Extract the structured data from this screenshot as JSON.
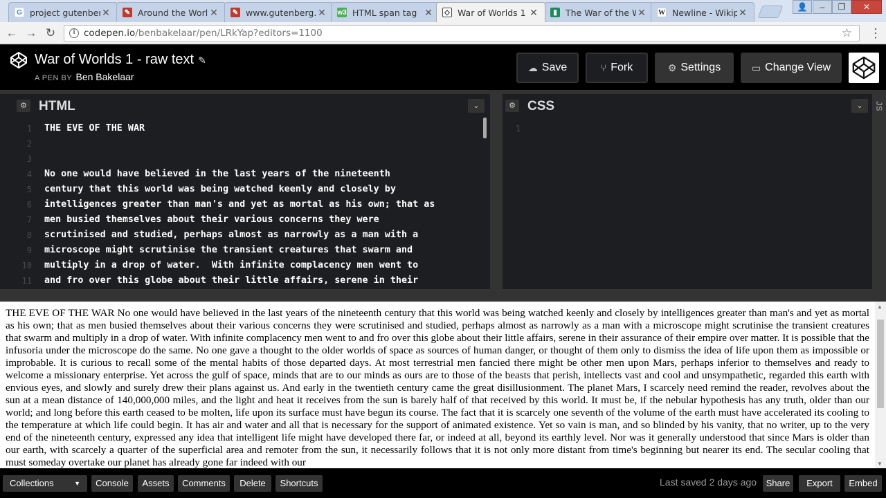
{
  "browser": {
    "tabs": [
      {
        "title": "project gutenberg",
        "favicon": "google-g-icon",
        "color": "#4285f4",
        "active": false
      },
      {
        "title": "Around the World",
        "favicon": "gutenberg-icon",
        "color": "#c0392b",
        "active": false
      },
      {
        "title": "www.gutenberg.org",
        "favicon": "gutenberg-icon",
        "color": "#c0392b",
        "active": false
      },
      {
        "title": "HTML span tag",
        "favicon": "w3schools-icon",
        "color": "#4caf50",
        "active": false
      },
      {
        "title": "War of Worlds 1",
        "favicon": "codepen-icon",
        "color": "#222222",
        "active": true
      },
      {
        "title": "The War of the W",
        "favicon": "book-icon",
        "color": "#1b8a5a",
        "active": false
      },
      {
        "title": "Newline - Wikipe",
        "favicon": "wikipedia-w-icon",
        "color": "#ffffff",
        "active": false
      }
    ],
    "url_host": "codepen.io",
    "url_path": "/benbakelaar/pen/LRkYap?editors=1100"
  },
  "header": {
    "pen_title": "War of Worlds 1 - raw text",
    "by_prefix": "A PEN BY",
    "author": "Ben Bakelaar",
    "buttons": {
      "save": "Save",
      "fork": "Fork",
      "settings": "Settings",
      "change_view": "Change View"
    }
  },
  "editors": {
    "html": {
      "title": "HTML",
      "lines": [
        {
          "n": "1",
          "text": "THE EVE OF THE WAR"
        },
        {
          "n": "2",
          "text": ""
        },
        {
          "n": "3",
          "text": ""
        },
        {
          "n": "4",
          "text": "No one would have believed in the last years of the nineteenth"
        },
        {
          "n": "5",
          "text": "century that this world was being watched keenly and closely by"
        },
        {
          "n": "6",
          "text": "intelligences greater than man's and yet as mortal as his own; that as"
        },
        {
          "n": "7",
          "text": "men busied themselves about their various concerns they were"
        },
        {
          "n": "8",
          "text": "scrutinised and studied, perhaps almost as narrowly as a man with a"
        },
        {
          "n": "9",
          "text": "microscope might scrutinise the transient creatures that swarm and"
        },
        {
          "n": "10",
          "text": "multiply in a drop of water.  With infinite complacency men went to"
        },
        {
          "n": "11",
          "text": "and fro over this globe about their little affairs, serene in their"
        }
      ]
    },
    "css": {
      "title": "CSS",
      "lines": [
        {
          "n": "1",
          "text": ""
        }
      ]
    },
    "side_tab": "JS"
  },
  "preview": {
    "text": "THE EVE OF THE WAR No one would have believed in the last years of the nineteenth century that this world was being watched keenly and closely by intelligences greater than man's and yet as mortal as his own; that as men busied themselves about their various concerns they were scrutinised and studied, perhaps almost as narrowly as a man with a microscope might scrutinise the transient creatures that swarm and multiply in a drop of water. With infinite complacency men went to and fro over this globe about their little affairs, serene in their assurance of their empire over matter. It is possible that the infusoria under the microscope do the same. No one gave a thought to the older worlds of space as sources of human danger, or thought of them only to dismiss the idea of life upon them as impossible or improbable. It is curious to recall some of the mental habits of those departed days. At most terrestrial men fancied there might be other men upon Mars, perhaps inferior to themselves and ready to welcome a missionary enterprise. Yet across the gulf of space, minds that are to our minds as ours are to those of the beasts that perish, intellects vast and cool and unsympathetic, regarded this earth with envious eyes, and slowly and surely drew their plans against us. And early in the twentieth century came the great disillusionment. The planet Mars, I scarcely need remind the reader, revolves about the sun at a mean distance of 140,000,000 miles, and the light and heat it receives from the sun is barely half of that received by this world. It must be, if the nebular hypothesis has any truth, older than our world; and long before this earth ceased to be molten, life upon its surface must have begun its course. The fact that it is scarcely one seventh of the volume of the earth must have accelerated its cooling to the temperature at which life could begin. It has air and water and all that is necessary for the support of animated existence. Yet so vain is man, and so blinded by his vanity, that no writer, up to the very end of the nineteenth century, expressed any idea that intelligent life might have developed there far, or indeed at all, beyond its earthly level. Nor was it generally understood that since Mars is older than our earth, with scarcely a quarter of the superficial area and remoter from the sun, it necessarily follows that it is not only more distant from time's beginning but nearer its end. The secular cooling that must someday overtake our planet has already gone far indeed with our"
  },
  "footer": {
    "collections": "Collections",
    "console": "Console",
    "assets": "Assets",
    "comments": "Comments",
    "delete": "Delete",
    "shortcuts": "Shortcuts",
    "last_saved": "Last saved 2 days ago",
    "share": "Share",
    "export": "Export",
    "embed": "Embed"
  }
}
